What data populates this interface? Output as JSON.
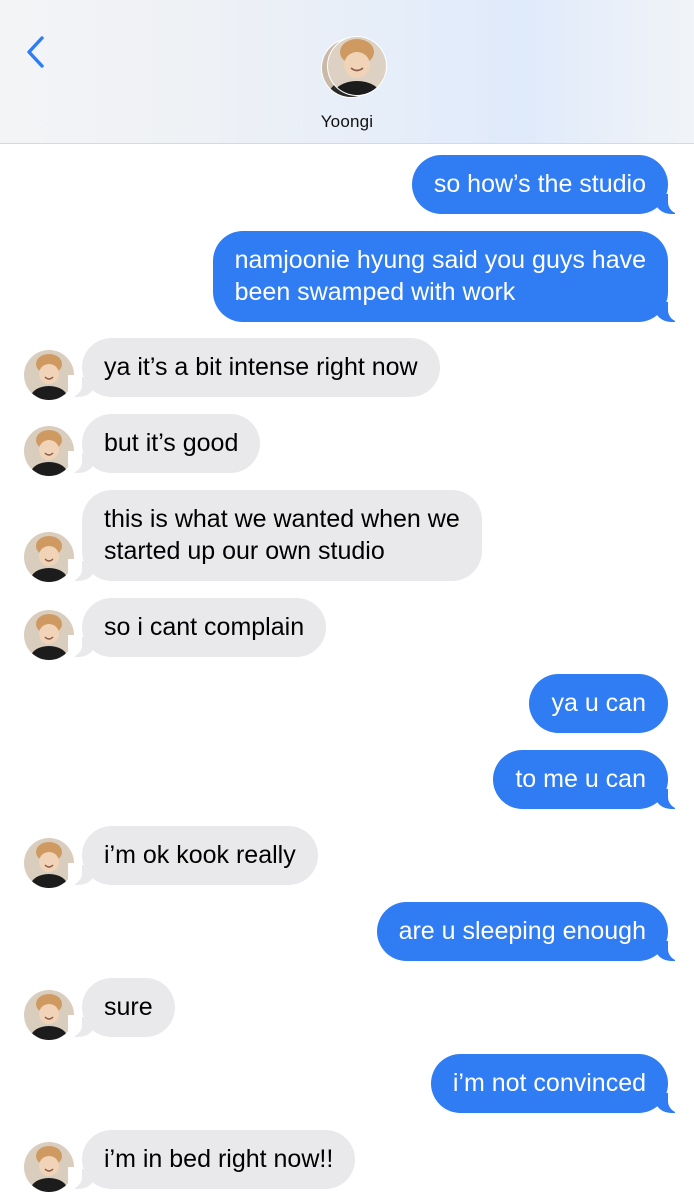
{
  "header": {
    "contact_name": "Yoongi",
    "back_icon": "chevron-left-icon",
    "accent_color": "#2f7cf3"
  },
  "messages": [
    {
      "from": "me",
      "text": "so how’s the studio"
    },
    {
      "from": "me",
      "text": "namjoonie hyung said you guys have\nbeen swamped with work"
    },
    {
      "from": "them",
      "text": "ya it’s a bit intense right now"
    },
    {
      "from": "them",
      "text": "but it’s good"
    },
    {
      "from": "them",
      "text": "this is what we wanted when we\nstarted up our own studio"
    },
    {
      "from": "them",
      "text": "so i cant complain"
    },
    {
      "from": "me",
      "text": "ya u can"
    },
    {
      "from": "me",
      "text": "to me u can"
    },
    {
      "from": "them",
      "text": "i’m ok kook really"
    },
    {
      "from": "me",
      "text": "are u sleeping enough"
    },
    {
      "from": "them",
      "text": "sure"
    },
    {
      "from": "me",
      "text": "i’m not convinced"
    },
    {
      "from": "them",
      "text": "i’m in bed right now!!"
    }
  ],
  "colors": {
    "sent_bubble": "#2f7cf3",
    "received_bubble": "#e9e9eb"
  }
}
